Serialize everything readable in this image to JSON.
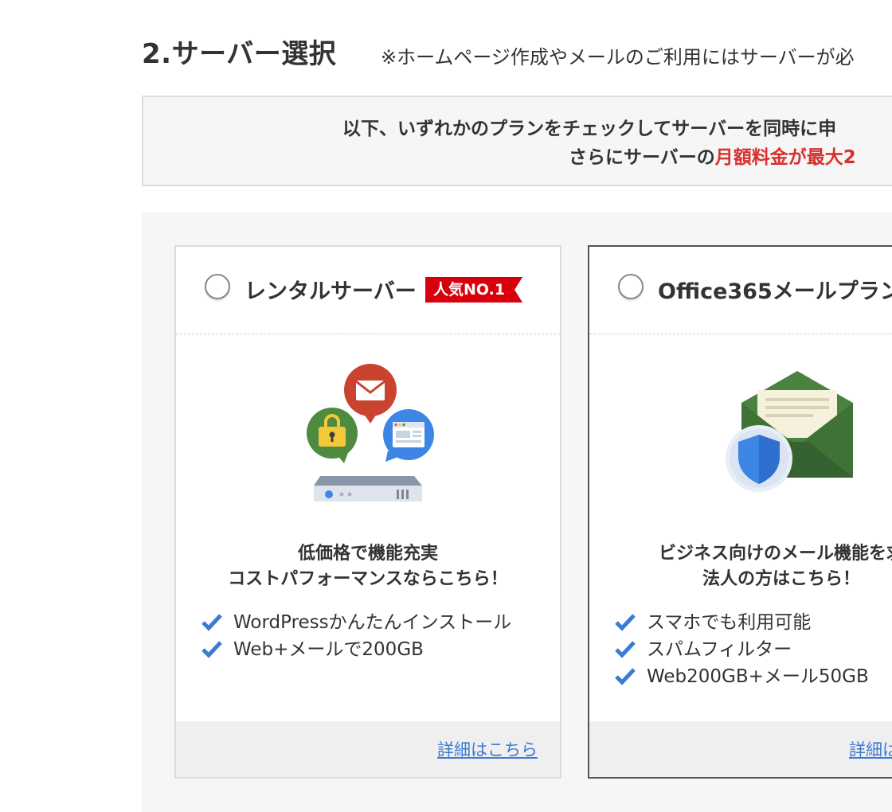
{
  "section": {
    "title": "2.サーバー選択",
    "note": "※ホームページ作成やメールのご利用にはサーバーが必"
  },
  "info": {
    "line1": "以下、いずれかのプランをチェックしてサーバーを同時に申",
    "line2_prefix": "さらにサーバーの",
    "line2_highlight": "月額料金が最大2"
  },
  "plans": [
    {
      "title": "レンタルサーバー",
      "badge": "人気NO.1",
      "desc_line1": "低価格で機能充実",
      "desc_line2": "コストパフォーマンスならこちら！",
      "features": [
        "WordPressかんたんインストール",
        "Web+メールで200GB"
      ],
      "link": "詳細はこちら",
      "illustration": "server-services-icon"
    },
    {
      "title": "Office365メールプラン",
      "desc_line1": "ビジネス向けのメール機能を求",
      "desc_line2": "法人の方はこちら！",
      "features": [
        "スマホでも利用可能",
        "スパムフィルター",
        "Web200GB+メール50GB"
      ],
      "link": "詳細は",
      "illustration": "secure-mail-icon"
    }
  ],
  "colors": {
    "accent_red": "#d9302f",
    "badge_red": "#d9000d",
    "link_blue": "#3a7bd5",
    "check_blue": "#3a7bd5"
  }
}
